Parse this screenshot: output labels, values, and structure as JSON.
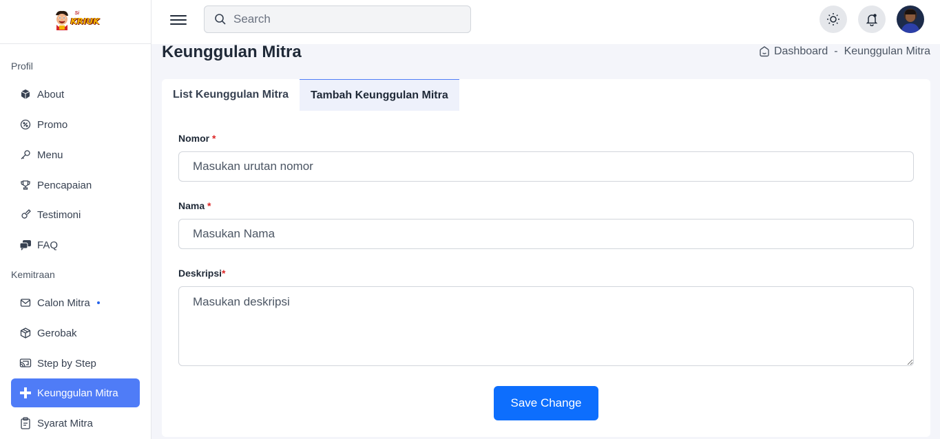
{
  "logo": {
    "small_text": "Si",
    "word": "KRIUK"
  },
  "sidebar": {
    "sections": [
      {
        "title": "Profil"
      },
      {
        "title": "Kemitraan"
      }
    ],
    "items": [
      {
        "label": "About",
        "icon": "box-icon"
      },
      {
        "label": "Promo",
        "icon": "discount-icon"
      },
      {
        "label": "Menu",
        "icon": "key-icon"
      },
      {
        "label": "Pencapaian",
        "icon": "trophy-icon"
      },
      {
        "label": "Testimoni",
        "icon": "guitar-icon"
      },
      {
        "label": "FAQ",
        "icon": "messages-icon"
      },
      {
        "label": "Calon Mitra",
        "icon": "mail-icon",
        "has_dot": true
      },
      {
        "label": "Gerobak",
        "icon": "package-icon"
      },
      {
        "label": "Step by Step",
        "icon": "cast-icon"
      },
      {
        "label": "Keunggulan Mitra",
        "icon": "plus-icon",
        "active": true
      },
      {
        "label": "Syarat Mitra",
        "icon": "clipboard-icon"
      }
    ]
  },
  "topbar": {
    "search_placeholder": "Search"
  },
  "page": {
    "title": "Keunggulan Mitra",
    "breadcrumb": [
      "Dashboard",
      "-",
      "Keunggulan Mitra"
    ]
  },
  "tabs": [
    {
      "label": "List Keunggulan Mitra",
      "active": false
    },
    {
      "label": "Tambah Keunggulan Mitra",
      "active": true
    }
  ],
  "form": {
    "nomor": {
      "label": "Nomor",
      "required_mark": "*",
      "placeholder": "Masukan urutan nomor",
      "value": ""
    },
    "nama": {
      "label": "Nama",
      "required_mark": "*",
      "placeholder": "Masukan Nama",
      "value": ""
    },
    "deskripsi": {
      "label": "Deskripsi",
      "required_mark": "*",
      "placeholder": "Masukan deskripsi",
      "value": ""
    },
    "save_label": "Save Change"
  },
  "colors": {
    "accent": "#4f7cf7",
    "primary_button": "#0d6efd",
    "required": "#dc2626"
  }
}
